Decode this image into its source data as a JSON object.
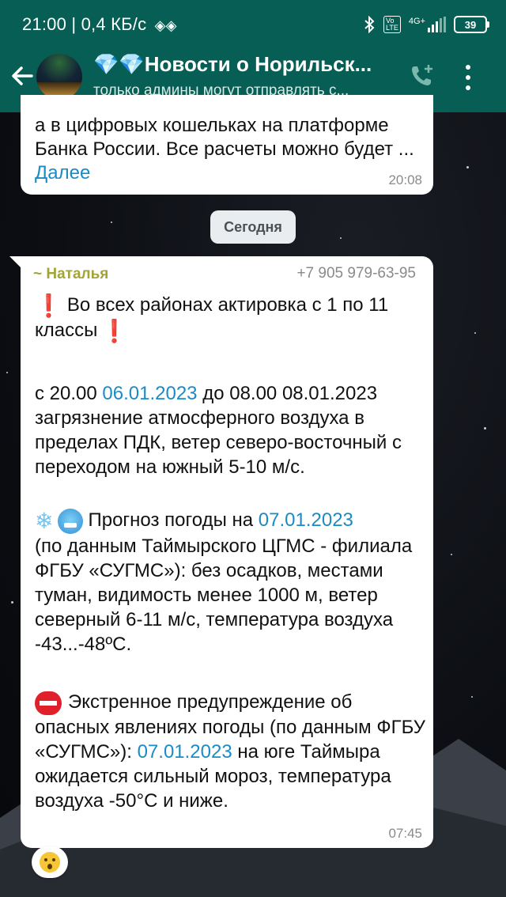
{
  "status_bar": {
    "time": "21:00",
    "network_speed": "0,4 КБ/с",
    "battery_level": "39",
    "icons": [
      "bluetooth-icon",
      "volte-icon",
      "signal-4g-icon",
      "battery-icon"
    ]
  },
  "app_bar": {
    "title": "💎💎Новости о Норильск...",
    "subtitle": "только админы могут отправлять с...",
    "icons": [
      "back-arrow-icon",
      "add-call-icon",
      "more-vertical-icon"
    ]
  },
  "messages": [
    {
      "text": "а в цифровых кошельках на платформе Банка России. Все расчеты можно будет ...",
      "more_link": "Далее",
      "time": "20:08"
    }
  ],
  "date_chip": "Сегодня",
  "message2": {
    "sender": "~ Наталья",
    "phone": "+7 905 979-63-95",
    "p1": "Во всех районах актировка с 1 по 11 классы",
    "p2_a": "с 20.00 ",
    "p2_date": "06.01.2023",
    "p2_b": " до 08.00 08.01.2023 загрязнение атмосферного воздуха в пределах ПДК, ветер северо-восточный с переходом на южный 5-10 м/с.",
    "p3_a": "Прогноз погоды на ",
    "p3_date": "07.01.2023",
    "p3_b": "(по данным Таймырского ЦГМС - филиала ФГБУ «СУГМС»): без осадков, местами туман, видимость менее 1000 м, ветер северный 6-11 м/с, температура воздуха -43...-48ºС.",
    "p4_a": "Экстренное предупреждение об опасных явлениях погоды (по данным ФГБУ «СУГМС»): ",
    "p4_date": "07.01.2023",
    "p4_b": " на юге Таймыра ожидается сильный мороз, температура воздуха -50°С и ниже.",
    "time": "07:45",
    "reaction": "astonished-face"
  },
  "colors": {
    "header": "#075e54",
    "link": "#1b8bc6",
    "sender": "#a2a437"
  }
}
